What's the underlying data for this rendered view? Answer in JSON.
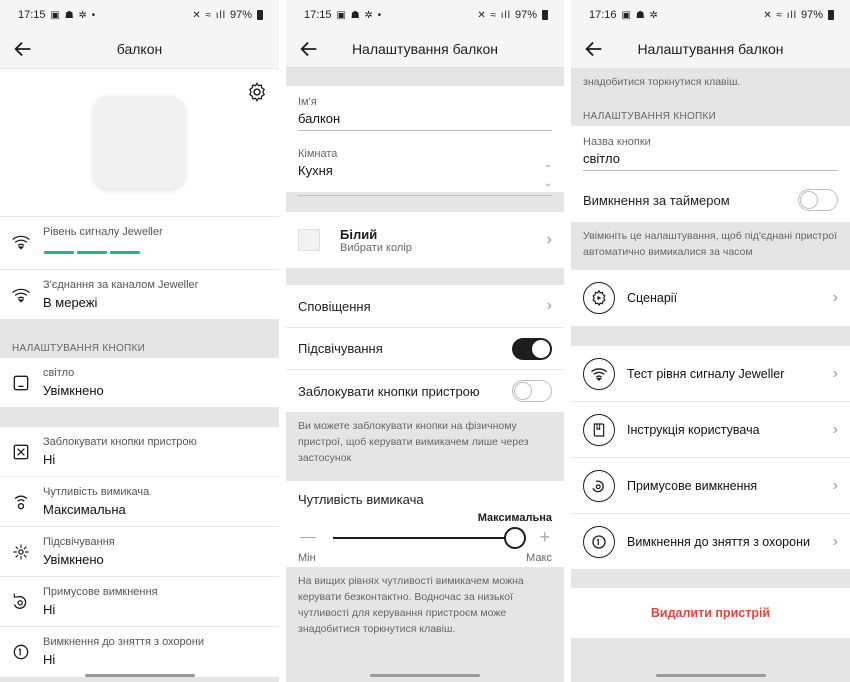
{
  "panel1": {
    "status": {
      "time": "17:15",
      "battery": "97%"
    },
    "title": "балкон",
    "rows_top": [
      {
        "title": "Рівень сигналу Jeweller",
        "value": ""
      },
      {
        "title": "З'єднання за каналом Jeweller",
        "value": "В мережі"
      }
    ],
    "section_header": "НАЛАШТУВАННЯ КНОПКИ",
    "button_row": {
      "title": "світло",
      "value": "Увімкнено"
    },
    "rows_bottom": [
      {
        "title": "Заблокувати кнопки пристрою",
        "value": "Ні"
      },
      {
        "title": "Чутливість вимикача",
        "value": "Максимальна"
      },
      {
        "title": "Підсвічування",
        "value": "Увімкнено"
      },
      {
        "title": "Примусове вимкнення",
        "value": "Ні"
      },
      {
        "title": "Вимкнення до зняття з охорони",
        "value": "Ні"
      }
    ]
  },
  "panel2": {
    "status": {
      "time": "17:15",
      "battery": "97%"
    },
    "title": "Налаштування балкон",
    "name_label": "Ім'я",
    "name_value": "балкон",
    "room_label": "Кімната",
    "room_value": "Кухня",
    "color_title": "Білий",
    "color_sub": "Вибрати колір",
    "notifications": "Сповіщення",
    "backlight": "Підсвічування",
    "lock_buttons": "Заблокувати кнопки пристрою",
    "lock_note": "Ви можете заблокувати кнопки на фізичному пристрої, щоб керувати вимикачем лише через застосунок",
    "sensitivity_title": "Чутливість вимикача",
    "sensitivity_value": "Максимальна",
    "sensitivity_level": 1.0,
    "min_label": "Мін",
    "max_label": "Макс",
    "sensitivity_note": "На вищих рівнях чутливості вимикачем можна керувати безконтактно. Водночас за низької чутливості для керування пристроєм може знадобитися торкнутися клавіш."
  },
  "panel3": {
    "status": {
      "time": "17:16",
      "battery": "97%"
    },
    "title": "Налаштування балкон",
    "top_note": "знадобитися торкнутися клавіш.",
    "section_header": "НАЛАШТУВАННЯ КНОПКИ",
    "button_name_label": "Назва кнопки",
    "button_name_value": "світло",
    "timer_label": "Вимкнення за таймером",
    "timer_note": "Увімкніть це налаштування, щоб під'єднані пристрої автоматично вимикалися за часом",
    "scenarios": "Сценарії",
    "signal_test": "Тест рівня сигналу Jeweller",
    "manual": "Інструкція користувача",
    "force_off": "Примусове вимкнення",
    "disarm_off": "Вимкнення до зняття з охорони",
    "delete": "Видалити пристрій"
  },
  "colors": {
    "accent_green": "#1fb58a",
    "delete_red": "#e0463a",
    "toggle_on": "#1d1d1f"
  }
}
